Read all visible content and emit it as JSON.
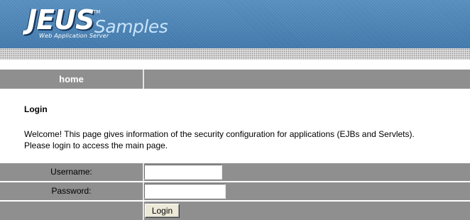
{
  "banner": {
    "logo_main": "JEUS",
    "logo_trademark": "TM",
    "logo_subtitle": "Web Application Server",
    "logo_samples": "Samples"
  },
  "nav": {
    "home_label": "home"
  },
  "content": {
    "heading": "Login",
    "description_line1": "Welcome! This page gives information of the security configuration for applications (EJBs and Servlets).",
    "description_line2": "Please login to access the main page."
  },
  "form": {
    "username_label": "Username:",
    "username_value": "",
    "password_label": "Password:",
    "password_value": "",
    "login_button": "Login"
  },
  "colors": {
    "banner_blue": "#4b86b9",
    "bar_gray": "#8f8f8f",
    "samples_text": "#c8e4fb"
  }
}
